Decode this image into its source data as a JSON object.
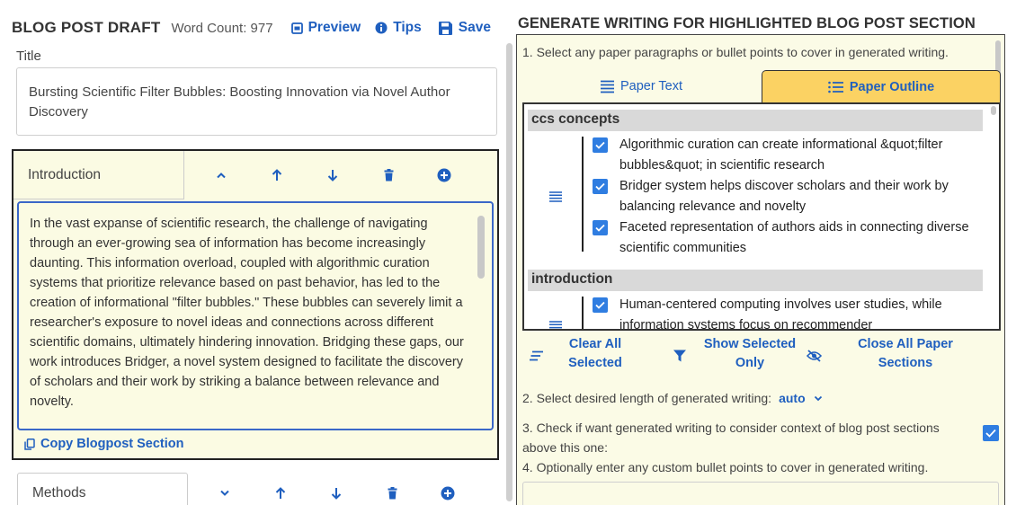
{
  "colors": {
    "accent": "#1f5fbf",
    "section_bg": "#fbfbe3",
    "tab_active_bg": "#fbd263",
    "checkbox": "#2f7de1",
    "group_header_bg": "#d9d9d9"
  },
  "draft": {
    "title": "BLOG POST DRAFT",
    "word_count": "Word Count: 977",
    "preview_label": "Preview",
    "tips_label": "Tips",
    "save_label": "Save",
    "title_field_label": "Title",
    "title_value": "Bursting Scientific Filter Bubbles: Boosting Innovation via Novel Author Discovery"
  },
  "sections": [
    {
      "name": "Introduction",
      "text": "In the vast expanse of scientific research, the challenge of navigating through an ever-growing sea of information has become increasingly daunting. This information overload, coupled with algorithmic curation systems that prioritize relevance based on past behavior, has led to the creation of informational \"filter bubbles.\" These bubbles can severely limit a researcher's exposure to novel ideas and connections across different scientific domains, ultimately hindering innovation. Bridging these gaps, our work introduces Bridger, a novel system designed to facilitate the discovery of scholars and their work by striking a balance between relevance and novelty.",
      "copy_label": "Copy Blogpost Section"
    },
    {
      "name": "Methods"
    }
  ],
  "generator": {
    "heading": "GENERATE WRITING FOR HIGHLIGHTED BLOG POST SECTION",
    "step1": "1. Select any paper paragraphs or bullet points to cover in generated writing.",
    "tab_text": "Paper Text",
    "tab_outline": "Paper Outline",
    "groups": [
      {
        "name": "ccs concepts",
        "items": [
          "Algorithmic curation can create informational &quot;filter bubbles&quot; in scientific research",
          "Bridger system helps discover scholars and their work by balancing relevance and novelty",
          "Faceted representation of authors aids in connecting diverse scientific communities"
        ]
      },
      {
        "name": "introduction",
        "items": [
          "Human-centered computing involves user studies, while information systems focus on recommender"
        ]
      }
    ],
    "clear_all": "Clear All Selected",
    "show_selected": "Show Selected Only",
    "close_all": "Close All Paper Sections",
    "step2": "2. Select desired length of generated writing:",
    "length_value": "auto",
    "step3": "3. Check if want generated writing to consider context of blog post sections above this one:",
    "step4": "4. Optionally enter any custom bullet points to cover in generated writing."
  }
}
